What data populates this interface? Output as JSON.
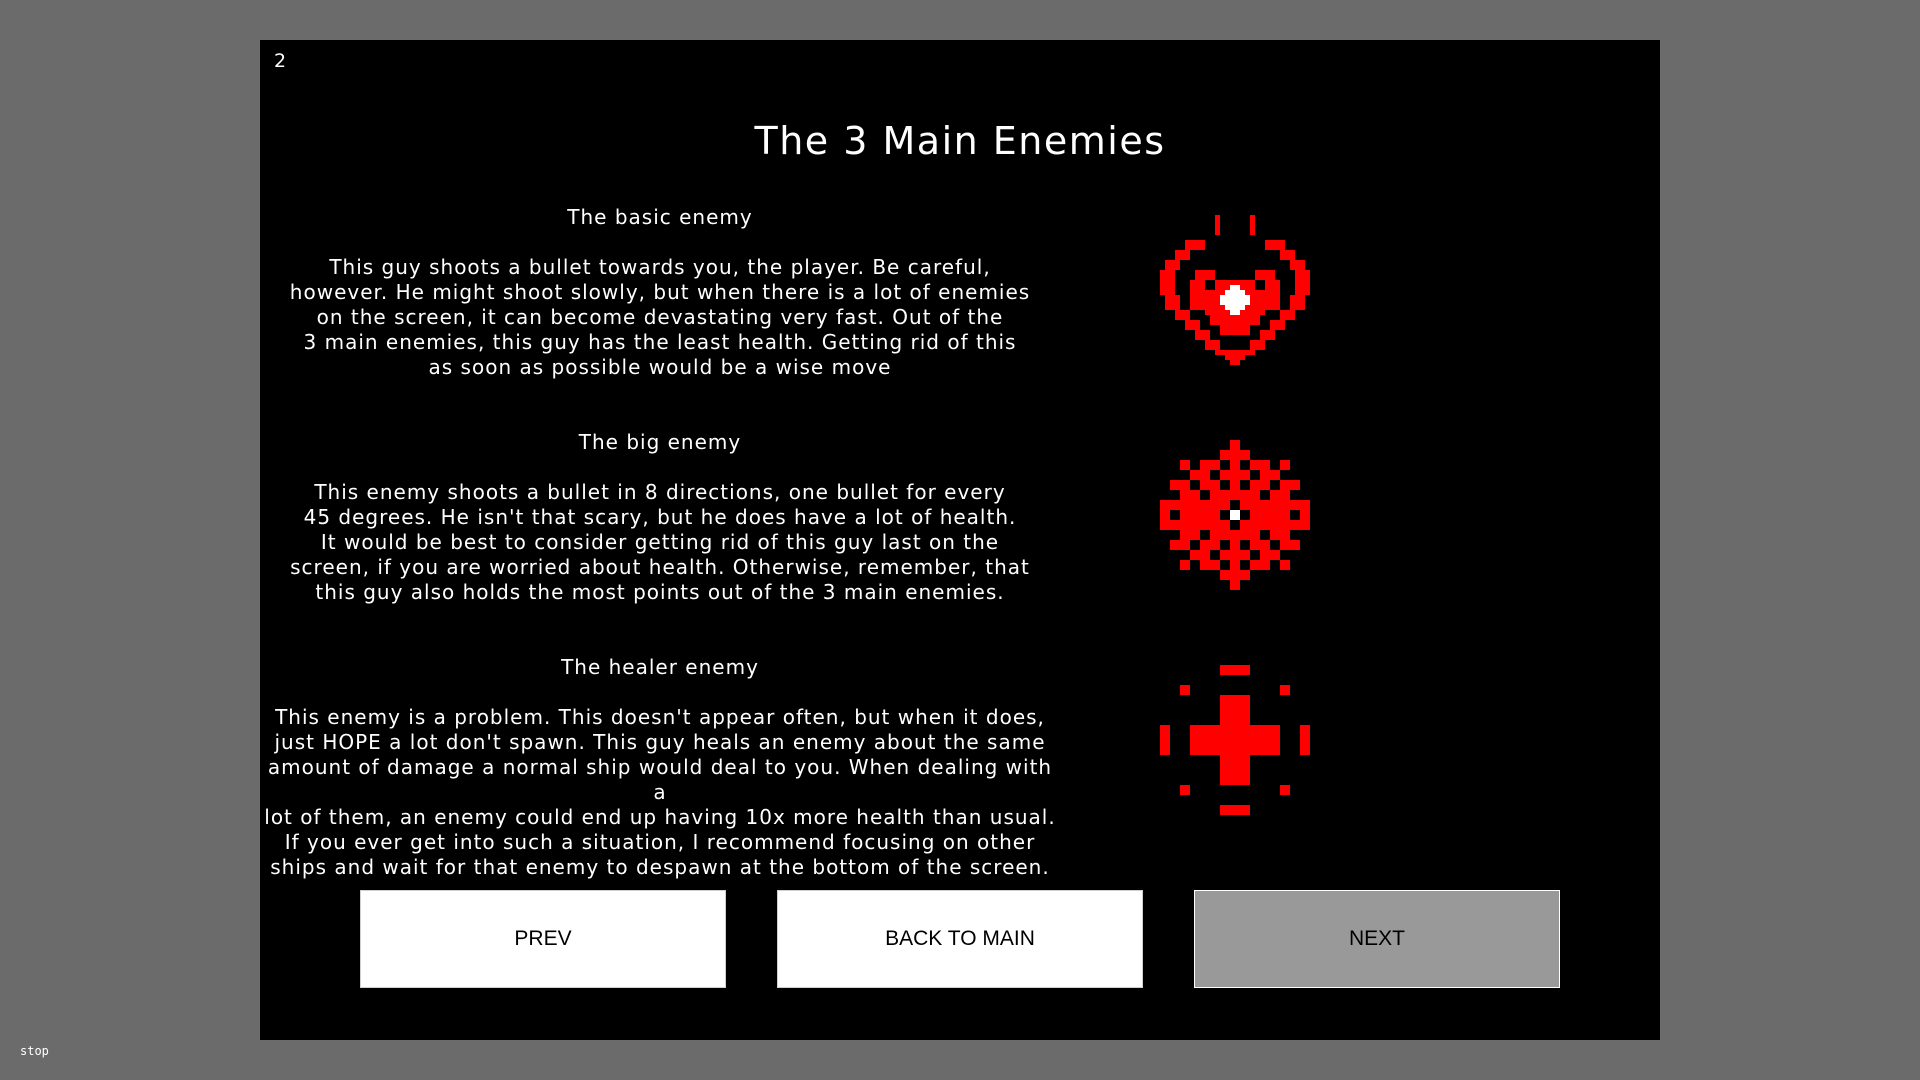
{
  "page": {
    "number": "2",
    "title": "The 3 Main Enemies"
  },
  "enemies": [
    {
      "name": "The basic enemy",
      "description": "This guy shoots a bullet towards you, the player. Be careful,\nhowever. He might shoot slowly, but when there is a lot of enemies\non the screen, it can become devastating very fast. Out of the\n3 main enemies, this guy has the least health. Getting rid of this\nas soon as possible would be a wise move",
      "icon": "basic-enemy-sprite-icon"
    },
    {
      "name": "The big enemy",
      "description": "This enemy shoots a bullet in 8 directions, one bullet for every\n45 degrees. He isn't that scary, but he does have a lot of health.\nIt would be best to consider getting rid of this guy last on the\nscreen, if you are worried about health. Otherwise, remember, that\nthis guy also holds the most points out of the 3 main enemies.",
      "icon": "big-enemy-sprite-icon"
    },
    {
      "name": "The healer enemy",
      "description": "This enemy is a problem. This doesn't appear often, but when it does,\njust HOPE a lot don't spawn. This guy heals an enemy about the same\namount of damage a normal ship would deal to you. When dealing with a\nlot of them, an enemy could end up having 10x more health than usual.\nIf you ever get into such a situation, I recommend focusing on other\nships and wait for that enemy to despawn at the bottom of the screen.",
      "icon": "healer-enemy-sprite-icon"
    }
  ],
  "buttons": {
    "prev_label": "PREV",
    "back_label": "BACK TO MAIN",
    "next_label": "NEXT"
  },
  "status": {
    "label": "stop"
  },
  "colors": {
    "background": "#6b6b6b",
    "canvas": "#000000",
    "enemy_red": "#ff0000",
    "text": "#ffffff",
    "button": "#ffffff",
    "button_disabled": "#999999"
  }
}
